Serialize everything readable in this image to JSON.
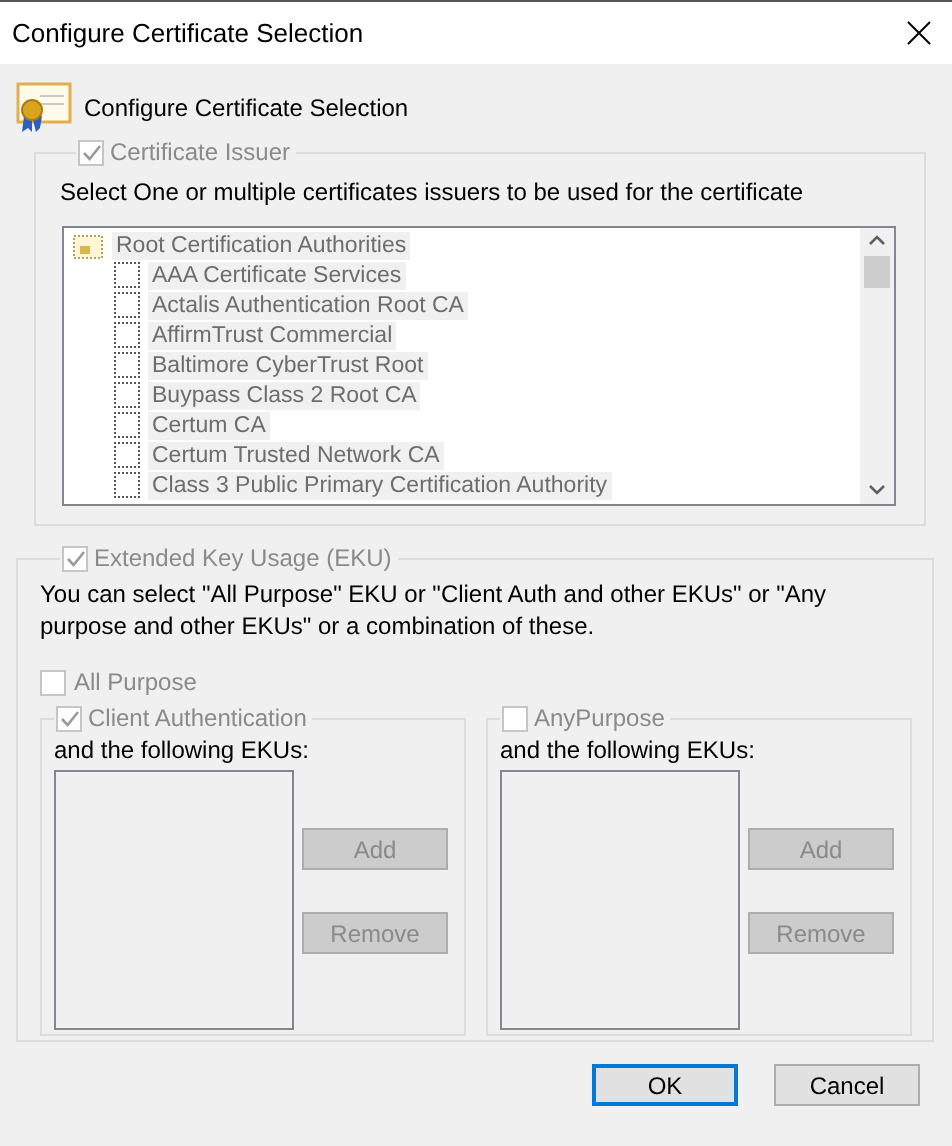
{
  "window": {
    "title": "Configure Certificate Selection"
  },
  "header": {
    "title": "Configure Certificate Selection"
  },
  "issuer_group": {
    "label": "Certificate Issuer",
    "checked": true,
    "disabled": true,
    "description": "Select One or multiple certificates issuers to be used for the certificate",
    "tree": {
      "label": "Root Certification Authorities",
      "children": [
        {
          "label": "AAA Certificate Services",
          "checked": false
        },
        {
          "label": "Actalis Authentication Root CA",
          "checked": false
        },
        {
          "label": "AffirmTrust Commercial",
          "checked": false
        },
        {
          "label": "Baltimore CyberTrust Root",
          "checked": false
        },
        {
          "label": "Buypass Class 2 Root CA",
          "checked": false
        },
        {
          "label": "Certum CA",
          "checked": false
        },
        {
          "label": "Certum Trusted Network CA",
          "checked": false
        },
        {
          "label": "Class 3 Public Primary Certification Authority",
          "checked": false
        }
      ]
    }
  },
  "eku_group": {
    "label": "Extended Key Usage (EKU)",
    "checked": true,
    "disabled": true,
    "description": "You can select \"All Purpose\" EKU or \"Client Auth and other EKUs\" or \"Any purpose and other EKUs\" or a combination of these.",
    "all_purpose": {
      "label": "All Purpose",
      "checked": false
    },
    "panels": [
      {
        "label": "Client Authentication",
        "checked": true,
        "list_label": "and the following EKUs:",
        "buttons": [
          {
            "label": "Add",
            "disabled": true
          },
          {
            "label": "Remove",
            "disabled": true
          }
        ]
      },
      {
        "label": "AnyPurpose",
        "checked": false,
        "list_label": "and the following EKUs:",
        "buttons": [
          {
            "label": "Add",
            "disabled": true
          },
          {
            "label": "Remove",
            "disabled": true
          }
        ]
      }
    ]
  },
  "buttons": [
    {
      "label": "OK",
      "default": true
    },
    {
      "label": "Cancel",
      "default": false
    }
  ]
}
